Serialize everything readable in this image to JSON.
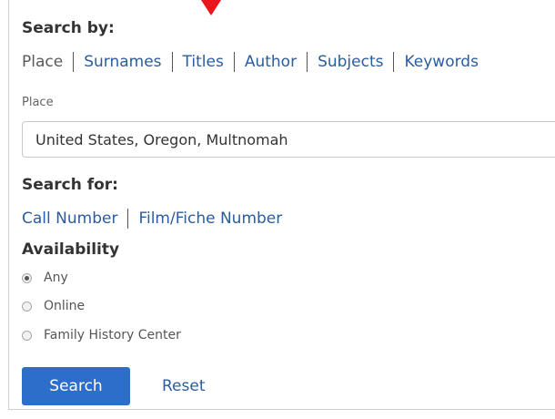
{
  "search_by": {
    "heading": "Search by:",
    "tabs": [
      {
        "label": "Place",
        "active": true
      },
      {
        "label": "Surnames",
        "active": false
      },
      {
        "label": "Titles",
        "active": false
      },
      {
        "label": "Author",
        "active": false
      },
      {
        "label": "Subjects",
        "active": false
      },
      {
        "label": "Keywords",
        "active": false
      }
    ]
  },
  "place_field": {
    "label": "Place",
    "value": "United States, Oregon, Multnomah"
  },
  "search_for": {
    "heading": "Search for:",
    "links": [
      "Call Number",
      "Film/Fiche Number"
    ]
  },
  "availability": {
    "heading": "Availability",
    "options": [
      {
        "label": "Any",
        "selected": true
      },
      {
        "label": "Online",
        "selected": false
      },
      {
        "label": "Family History Center",
        "selected": false
      }
    ]
  },
  "actions": {
    "search_label": "Search",
    "reset_label": "Reset"
  },
  "colors": {
    "link": "#2a5d9f",
    "button": "#2d6ecb",
    "pointer_arrow": "#e8151c"
  }
}
